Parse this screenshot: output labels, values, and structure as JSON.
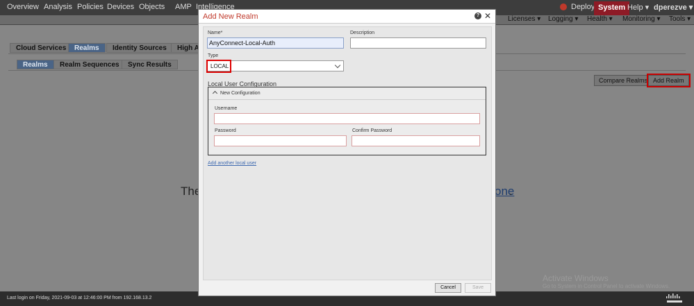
{
  "nav": {
    "items": [
      "Overview",
      "Analysis",
      "Policies",
      "Devices",
      "Objects",
      "AMP",
      "Intelligence"
    ],
    "deploy": "Deploy",
    "system": "System",
    "help": "Help ▾",
    "user": "dperezve ▾"
  },
  "subnav": {
    "items": [
      "Licenses ▾",
      "Logging ▾",
      "Health ▾",
      "Monitoring ▾",
      "Tools ▾"
    ]
  },
  "page": {
    "tabs": [
      "Cloud Services",
      "Realms",
      "Identity Sources",
      "High Av"
    ],
    "subtabs": [
      "Realms",
      "Realm Sequences",
      "Sync Results"
    ],
    "compare_realms": "Compare Realms",
    "add_realm": "Add Realm",
    "body_fragment_left": "The",
    "body_fragment_right": "one",
    "body_fragment_dot": "."
  },
  "modal": {
    "title": "Add New Realm",
    "name_label": "Name*",
    "name_value": "AnyConnect-Local-Auth",
    "description_label": "Description",
    "description_value": "",
    "type_label": "Type",
    "type_value": "LOCAL",
    "local_user_config_label": "Local User Configuration",
    "new_config_label": "New Configuration",
    "username_label": "Username",
    "password_label": "Password",
    "confirm_password_label": "Confirm Password",
    "add_user_link": "Add another local user",
    "cancel": "Cancel",
    "save": "Save"
  },
  "footer": {
    "last_login": "Last login on Friday, 2021-09-03 at 12:46:00 PM from 192.168.13.2"
  },
  "watermark": {
    "title": "Activate Windows",
    "subtitle": "Go to System in Control Panel to activate Windows."
  },
  "colors": {
    "accent_red": "#c0392b",
    "active_tab": "#4a6486",
    "system_tab": "#8e1b26"
  }
}
